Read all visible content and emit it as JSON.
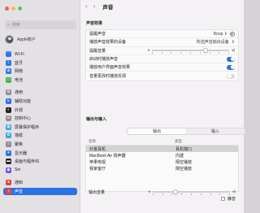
{
  "window": {
    "traffic_colors": [
      "#ee5f57",
      "#f4bd4f",
      "#5fc454"
    ],
    "title": "声音"
  },
  "sidebar": {
    "search_placeholder": "搜索",
    "account_name": "Apple账户",
    "items": [
      {
        "label": "Wi-Fi",
        "icon": "wifi-icon",
        "color": "#2a72e6",
        "glyph": "◠",
        "group": 1
      },
      {
        "label": "蓝牙",
        "icon": "bluetooth-icon",
        "color": "#2a72e6",
        "glyph": "ᛒ",
        "group": 1
      },
      {
        "label": "网络",
        "icon": "network-icon",
        "color": "#2a72e6",
        "glyph": "◍",
        "group": 1
      },
      {
        "label": "电池",
        "icon": "battery-icon",
        "color": "#49b34c",
        "glyph": "▭",
        "group": 1
      },
      {
        "label": "通用",
        "icon": "gear-icon",
        "color": "#8e8d93",
        "glyph": "⚙",
        "group": 2
      },
      {
        "label": "辅助功能",
        "icon": "accessibility-icon",
        "color": "#2a72e6",
        "glyph": "♿",
        "group": 2
      },
      {
        "label": "外观",
        "icon": "appearance-icon",
        "color": "#222222",
        "glyph": "◐",
        "group": 2
      },
      {
        "label": "控制中心",
        "icon": "control-center-icon",
        "color": "#8e8d93",
        "glyph": "☰",
        "group": 2
      },
      {
        "label": "屏幕保护程序",
        "icon": "screensaver-icon",
        "color": "#2fa6d9",
        "glyph": "▦",
        "group": 2
      },
      {
        "label": "墙纸",
        "icon": "wallpaper-icon",
        "color": "#2fa6d9",
        "glyph": "✿",
        "group": 2
      },
      {
        "label": "聚焦",
        "icon": "spotlight-icon",
        "color": "#8e8d93",
        "glyph": "⌕",
        "group": 2
      },
      {
        "label": "显示器",
        "icon": "display-icon",
        "color": "#2a72e6",
        "glyph": "☀",
        "group": 2
      },
      {
        "label": "桌面与程序坞",
        "icon": "dock-icon",
        "color": "#222222",
        "glyph": "▬",
        "group": 2
      },
      {
        "label": "Siri",
        "icon": "siri-icon",
        "color": "#6b4fe0",
        "glyph": "◉",
        "group": 2
      },
      {
        "label": "通知",
        "icon": "notifications-icon",
        "color": "#e8453c",
        "glyph": "●",
        "group": 3
      },
      {
        "label": "声音",
        "icon": "sound-icon",
        "color": "#e8453c",
        "glyph": "♪",
        "group": 3,
        "active": true
      }
    ]
  },
  "main": {
    "sound_effects_heading": "声音效果",
    "alert_sound_label": "提醒声音",
    "alert_sound_value": "Boop",
    "play_through_label": "播放声音效果的设备",
    "play_through_value": "所选声音输出设备",
    "alert_volume_label": "提醒音量",
    "alert_volume_level": 0.7,
    "startup_label": "启动时播放声音",
    "startup_on": true,
    "ui_effects_label": "播放用户界面声音效果",
    "ui_effects_on": true,
    "feedback_label": "音量更改时播放反馈",
    "feedback_on": false,
    "io_heading": "输出与输入",
    "tab_output": "输出",
    "tab_input": "输入",
    "col_name": "名称",
    "col_type": "类型",
    "devices": [
      {
        "name": "外置耳机",
        "type": "耳机端口",
        "selected": true
      },
      {
        "name": "MacBook Air 扬声器",
        "type": "内建",
        "selected": false
      },
      {
        "name": "苹果电视",
        "type": "隔空播放",
        "selected": false
      },
      {
        "name": "我家客厅",
        "type": "隔空播放",
        "selected": false
      }
    ],
    "output_volume_label": "输出音量",
    "output_volume_level": 0.3,
    "mute_label": "静音"
  }
}
